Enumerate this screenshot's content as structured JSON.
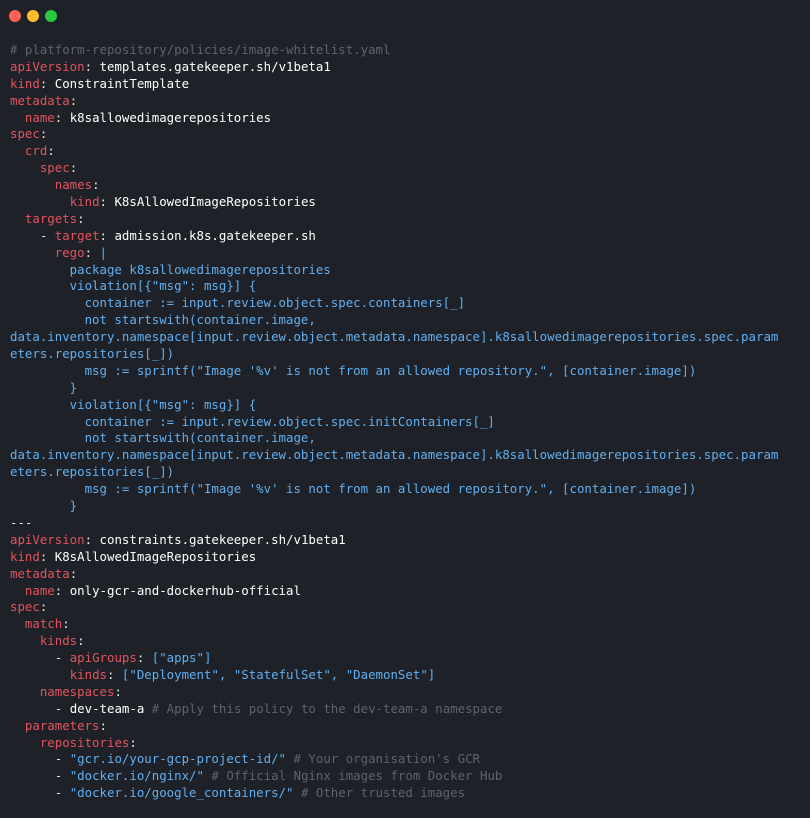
{
  "window": {
    "buttons": {
      "close_color": "#ff5f56",
      "minimize_color": "#ffbd2e",
      "maximize_color": "#27c93f"
    }
  },
  "colors": {
    "background": "#1e2127",
    "key": "#e2545d",
    "string": "#61afef",
    "comment": "#5c6370",
    "text": "#ffffff"
  },
  "code_lines": [
    [
      {
        "t": "# platform-repository/policies/image-whitelist.yaml",
        "c": "c"
      }
    ],
    [
      {
        "t": "apiVersion",
        "c": "k"
      },
      {
        "t": ": ",
        "c": "p"
      },
      {
        "t": "templates.gatekeeper.sh/v1beta1",
        "c": "v"
      }
    ],
    [
      {
        "t": "kind",
        "c": "k"
      },
      {
        "t": ": ",
        "c": "p"
      },
      {
        "t": "ConstraintTemplate",
        "c": "v"
      }
    ],
    [
      {
        "t": "metadata",
        "c": "k"
      },
      {
        "t": ":",
        "c": "p"
      }
    ],
    [
      {
        "t": "  ",
        "c": "p"
      },
      {
        "t": "name",
        "c": "k"
      },
      {
        "t": ": ",
        "c": "p"
      },
      {
        "t": "k8sallowedimagerepositories",
        "c": "v"
      }
    ],
    [
      {
        "t": "spec",
        "c": "k"
      },
      {
        "t": ":",
        "c": "p"
      }
    ],
    [
      {
        "t": "  ",
        "c": "p"
      },
      {
        "t": "crd",
        "c": "k"
      },
      {
        "t": ":",
        "c": "p"
      }
    ],
    [
      {
        "t": "    ",
        "c": "p"
      },
      {
        "t": "spec",
        "c": "k"
      },
      {
        "t": ":",
        "c": "p"
      }
    ],
    [
      {
        "t": "      ",
        "c": "p"
      },
      {
        "t": "names",
        "c": "k"
      },
      {
        "t": ":",
        "c": "p"
      }
    ],
    [
      {
        "t": "        ",
        "c": "p"
      },
      {
        "t": "kind",
        "c": "k"
      },
      {
        "t": ": ",
        "c": "p"
      },
      {
        "t": "K8sAllowedImageRepositories",
        "c": "v"
      }
    ],
    [
      {
        "t": "  ",
        "c": "p"
      },
      {
        "t": "targets",
        "c": "k"
      },
      {
        "t": ":",
        "c": "p"
      }
    ],
    [
      {
        "t": "    - ",
        "c": "p"
      },
      {
        "t": "target",
        "c": "k"
      },
      {
        "t": ": ",
        "c": "p"
      },
      {
        "t": "admission.k8s.gatekeeper.sh",
        "c": "v"
      }
    ],
    [
      {
        "t": "      ",
        "c": "p"
      },
      {
        "t": "rego",
        "c": "k"
      },
      {
        "t": ": ",
        "c": "p"
      },
      {
        "t": "|",
        "c": "s"
      }
    ],
    [
      {
        "t": "        package k8sallowedimagerepositories",
        "c": "s"
      }
    ],
    [
      {
        "t": "        violation[{\"msg\": msg}] {",
        "c": "s"
      }
    ],
    [
      {
        "t": "          container := input.review.object.spec.containers[_]",
        "c": "s"
      }
    ],
    [
      {
        "t": "          not startswith(container.image,",
        "c": "s"
      }
    ],
    [
      {
        "t": "data.inventory.namespace[input.review.object.metadata.namespace].k8sallowedimagerepositories.spec.param",
        "c": "s"
      }
    ],
    [
      {
        "t": "eters.repositories[_])",
        "c": "s"
      }
    ],
    [
      {
        "t": "          msg := sprintf(\"Image '%v' is not from an allowed repository.\", [container.image])",
        "c": "s"
      }
    ],
    [
      {
        "t": "        }",
        "c": "s"
      }
    ],
    [
      {
        "t": "        violation[{\"msg\": msg}] {",
        "c": "s"
      }
    ],
    [
      {
        "t": "          container := input.review.object.spec.initContainers[_]",
        "c": "s"
      }
    ],
    [
      {
        "t": "          not startswith(container.image,",
        "c": "s"
      }
    ],
    [
      {
        "t": "data.inventory.namespace[input.review.object.metadata.namespace].k8sallowedimagerepositories.spec.param",
        "c": "s"
      }
    ],
    [
      {
        "t": "eters.repositories[_])",
        "c": "s"
      }
    ],
    [
      {
        "t": "          msg := sprintf(\"Image '%v' is not from an allowed repository.\", [container.image])",
        "c": "s"
      }
    ],
    [
      {
        "t": "        }",
        "c": "s"
      }
    ],
    [
      {
        "t": "---",
        "c": "p"
      }
    ],
    [
      {
        "t": "apiVersion",
        "c": "k"
      },
      {
        "t": ": ",
        "c": "p"
      },
      {
        "t": "constraints.gatekeeper.sh/v1beta1",
        "c": "v"
      }
    ],
    [
      {
        "t": "kind",
        "c": "k"
      },
      {
        "t": ": ",
        "c": "p"
      },
      {
        "t": "K8sAllowedImageRepositories",
        "c": "v"
      }
    ],
    [
      {
        "t": "metadata",
        "c": "k"
      },
      {
        "t": ":",
        "c": "p"
      }
    ],
    [
      {
        "t": "  ",
        "c": "p"
      },
      {
        "t": "name",
        "c": "k"
      },
      {
        "t": ": ",
        "c": "p"
      },
      {
        "t": "only-gcr-and-dockerhub-official",
        "c": "v"
      }
    ],
    [
      {
        "t": "spec",
        "c": "k"
      },
      {
        "t": ":",
        "c": "p"
      }
    ],
    [
      {
        "t": "  ",
        "c": "p"
      },
      {
        "t": "match",
        "c": "k"
      },
      {
        "t": ":",
        "c": "p"
      }
    ],
    [
      {
        "t": "    ",
        "c": "p"
      },
      {
        "t": "kinds",
        "c": "k"
      },
      {
        "t": ":",
        "c": "p"
      }
    ],
    [
      {
        "t": "      - ",
        "c": "p"
      },
      {
        "t": "apiGroups",
        "c": "k"
      },
      {
        "t": ": ",
        "c": "p"
      },
      {
        "t": "[\"apps\"]",
        "c": "s"
      }
    ],
    [
      {
        "t": "        ",
        "c": "p"
      },
      {
        "t": "kinds",
        "c": "k"
      },
      {
        "t": ": ",
        "c": "p"
      },
      {
        "t": "[\"Deployment\", \"StatefulSet\", \"DaemonSet\"]",
        "c": "s"
      }
    ],
    [
      {
        "t": "    ",
        "c": "p"
      },
      {
        "t": "namespaces",
        "c": "k"
      },
      {
        "t": ":",
        "c": "p"
      }
    ],
    [
      {
        "t": "      - ",
        "c": "p"
      },
      {
        "t": "dev-team-a",
        "c": "v"
      },
      {
        "t": " # Apply this policy to the dev-team-a namespace",
        "c": "c"
      }
    ],
    [
      {
        "t": "  ",
        "c": "p"
      },
      {
        "t": "parameters",
        "c": "k"
      },
      {
        "t": ":",
        "c": "p"
      }
    ],
    [
      {
        "t": "    ",
        "c": "p"
      },
      {
        "t": "repositories",
        "c": "k"
      },
      {
        "t": ":",
        "c": "p"
      }
    ],
    [
      {
        "t": "      - ",
        "c": "p"
      },
      {
        "t": "\"gcr.io/your-gcp-project-id/\"",
        "c": "s"
      },
      {
        "t": " # Your organisation's GCR",
        "c": "c"
      }
    ],
    [
      {
        "t": "      - ",
        "c": "p"
      },
      {
        "t": "\"docker.io/nginx/\"",
        "c": "s"
      },
      {
        "t": " # Official Nginx images from Docker Hub",
        "c": "c"
      }
    ],
    [
      {
        "t": "      - ",
        "c": "p"
      },
      {
        "t": "\"docker.io/google_containers/\"",
        "c": "s"
      },
      {
        "t": " # Other trusted images",
        "c": "c"
      }
    ]
  ]
}
